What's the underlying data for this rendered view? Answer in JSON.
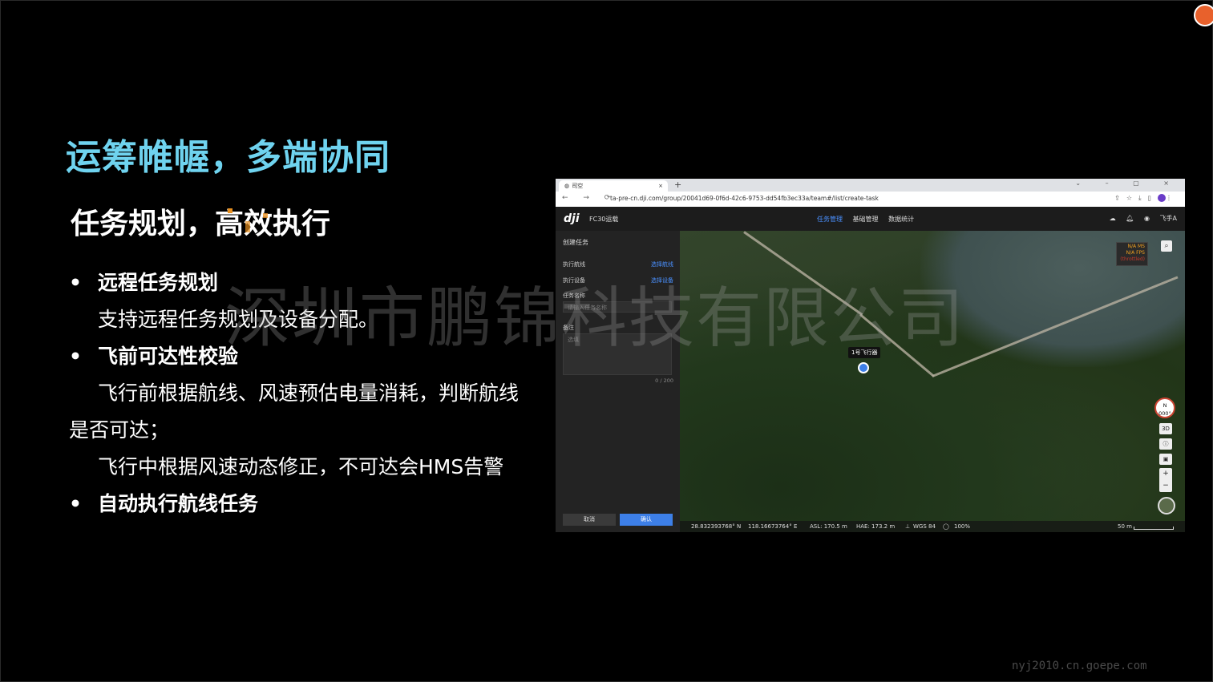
{
  "slide": {
    "title": "运筹帷幄，多端协同",
    "subtitle": "任务规划，高效执行",
    "bullets": [
      {
        "heading": "远程任务规划",
        "lines": [
          "支持远程任务规划及设备分配。"
        ]
      },
      {
        "heading": "飞前可达性校验",
        "lines": [
          "飞行前根据航线、风速预估电量消耗，判断航线是否可达；",
          "飞行中根据风速动态修正，不可达会HMS告警"
        ]
      },
      {
        "heading": "自动执行航线任务",
        "lines": []
      }
    ],
    "bullet_symbol": "•",
    "watermark": "深圳市鹏锦科技有限公司",
    "footer_url": "nyj2010.cn.goepe.com"
  },
  "browser": {
    "tab_title": "司空",
    "tab_close": "×",
    "new_tab": "+",
    "window_controls": "⌄ – ▢ ×",
    "nav_buttons": "← → ⟳",
    "url": "ta-pre-cn.dji.com/group/20041d69-0f6d-42c6-9753-dd54fb3ec33a/team#/list/create-task",
    "avatar_letter": "a"
  },
  "app": {
    "logo": "dji",
    "name": "FC30运载",
    "nav": [
      "任务管理",
      "基础管理",
      "数据统计"
    ],
    "active_nav": "任务管理",
    "user": "飞手A",
    "panel": {
      "title": "创建任务",
      "route_label": "执行航线",
      "route_link": "选择航线",
      "device_label": "执行设备",
      "device_link": "选择设备",
      "name_label": "任务名称",
      "name_placeholder": "请输入任务名称",
      "note_label": "备注",
      "note_placeholder": "选填",
      "counter": "0 / 200",
      "cancel": "取消",
      "confirm": "确认"
    },
    "map": {
      "info_line1": "N/A MS",
      "info_line2": "N/A FPS",
      "info_line3": "(throttled)",
      "drone_label": "1号飞行器",
      "compass_n": "N",
      "compass_deg": "000°",
      "ctl_3d": "3D",
      "zoom_in": "+",
      "zoom_out": "−",
      "lat": "28.832393768° N",
      "lon": "118.16673764° E",
      "asl": "ASL: 170.5 m",
      "hae": "HAE: 173.2 m",
      "datum": "WGS 84",
      "zoom_pct": "100%",
      "scale": "50 m"
    }
  },
  "colors": {
    "title": "#6fd3ef",
    "accent": "#3d7fe8",
    "link": "#4a90ff"
  }
}
